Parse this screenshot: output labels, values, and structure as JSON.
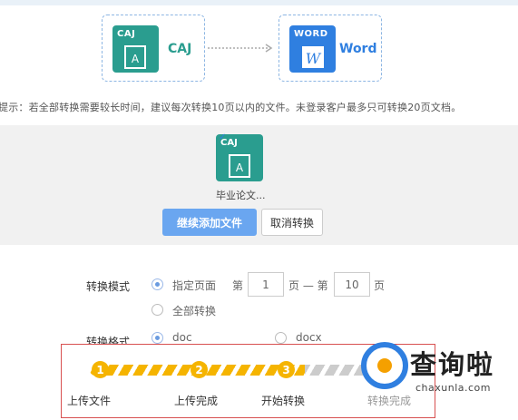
{
  "source": {
    "tag": "CAJ",
    "name": "CAJ",
    "color": "#2a9d8f"
  },
  "target": {
    "tag": "WORD",
    "name": "Word",
    "glyph": "W",
    "color": "#2f7fe0"
  },
  "tip": "提示：若全部转换需要较长时间，建议每次转换10页以内的文件。未登录客户最多只可转换20页文档。",
  "upload": {
    "tag": "CAJ",
    "file_name": "毕业论文...",
    "add_label": "继续添加文件",
    "cancel_label": "取消转换"
  },
  "mode": {
    "label": "转换模式",
    "option_pages": "指定页面",
    "page_prefix": "第",
    "start_page": "1",
    "dash": "页 — 第",
    "end_page": "10",
    "page_suffix": "页",
    "option_all": "全部转换",
    "selected": "指定页面"
  },
  "format": {
    "label": "转换格式",
    "option_doc": "doc",
    "option_docx": "docx",
    "selected": "doc"
  },
  "steps": [
    {
      "num": "1",
      "label": "上传文件"
    },
    {
      "num": "2",
      "label": "上传完成"
    },
    {
      "num": "3",
      "label": "开始转换"
    },
    {
      "label": "转换完成"
    }
  ],
  "watermark": {
    "text": "查询啦",
    "url": "chaxunla.com"
  },
  "colors": {
    "accent": "#6aa6f0",
    "progress": "#f5b400",
    "highlight_border": "#d85050"
  }
}
